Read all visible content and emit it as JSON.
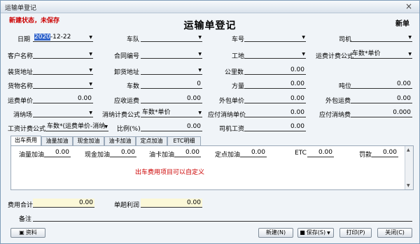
{
  "window": {
    "title": "运输单登记",
    "close_glyph": "×"
  },
  "header": {
    "status": "新建状态，未保存",
    "title": "运输单登记",
    "mode": "新单"
  },
  "fields": {
    "date": {
      "label": "日期",
      "value_year": "2020",
      "value_rest": "-12-22"
    },
    "fleet": {
      "label": "车队",
      "value": ""
    },
    "plate": {
      "label": "车号",
      "value": ""
    },
    "driver": {
      "label": "司机",
      "value": ""
    },
    "customer": {
      "label": "客户名称",
      "value": ""
    },
    "contract": {
      "label": "合同编号",
      "value": ""
    },
    "site": {
      "label": "工地",
      "value": ""
    },
    "freight_formula": {
      "label": "运费计费公式",
      "value": "车数*单价"
    },
    "load_addr": {
      "label": "装货地址",
      "value": ""
    },
    "unload_addr": {
      "label": "卸货地址",
      "value": ""
    },
    "km": {
      "label": "公里数",
      "value": "0.00"
    },
    "goods": {
      "label": "货物名称",
      "value": ""
    },
    "cars": {
      "label": "车数",
      "value": "0"
    },
    "tonnage": {
      "label": "吨位",
      "value": "0.00"
    },
    "freight_price": {
      "label": "运费单价",
      "value": "0.00"
    },
    "receivable": {
      "label": "应收运费",
      "value": "0.00"
    },
    "volume": {
      "label": "方量",
      "value": "0.00"
    },
    "outsource_price": {
      "label": "外包单价",
      "value": "0.00"
    },
    "outsource_fee": {
      "label": "外包运费",
      "value": "0.00"
    },
    "consumer_site": {
      "label": "消纳场",
      "value": ""
    },
    "consume_formula": {
      "label": "消纳计费公式",
      "value": "车数*单价"
    },
    "consume_price": {
      "label": "应付消纳单价",
      "value": "0.00"
    },
    "consume_fee": {
      "label": "应付消纳费",
      "value": "0.000"
    },
    "wage_formula": {
      "label": "工资计费公式",
      "value": "车数*(运费单价-消纳"
    },
    "ratio": {
      "label": "比例(%)",
      "value": "0.00"
    },
    "driver_wage": {
      "label": "司机工资",
      "value": "0.00"
    }
  },
  "tabs": [
    "出车费用",
    "油量加油",
    "现金加油",
    "油卡加油",
    "定点加油",
    "ETC明细"
  ],
  "panel": {
    "items": [
      {
        "label": "油量加油",
        "value": "0.00"
      },
      {
        "label": "现金加油",
        "value": "0.00"
      },
      {
        "label": "油卡加油",
        "value": "0.00"
      },
      {
        "label": "定点加油",
        "value": "0.00"
      },
      {
        "label": "ETC",
        "value": "0.00"
      },
      {
        "label": "罚款",
        "value": "0.00"
      }
    ],
    "note": "出车费用项目可以自定义"
  },
  "footer": {
    "total_fee": {
      "label": "费用合计",
      "value": "0.00"
    },
    "profit": {
      "label": "单趟利润",
      "value": "0.00"
    },
    "remark": {
      "label": "备注",
      "value": ""
    }
  },
  "buttons": {
    "attachment": "资料",
    "new": "新建(N)",
    "save": "保存(S)",
    "print": "打印(P)",
    "close": "关闭(C)"
  },
  "colors": {
    "status_red": "#cc0000",
    "selection_blue": "#3366cc",
    "summary_yellow": "#fbf8d8"
  }
}
